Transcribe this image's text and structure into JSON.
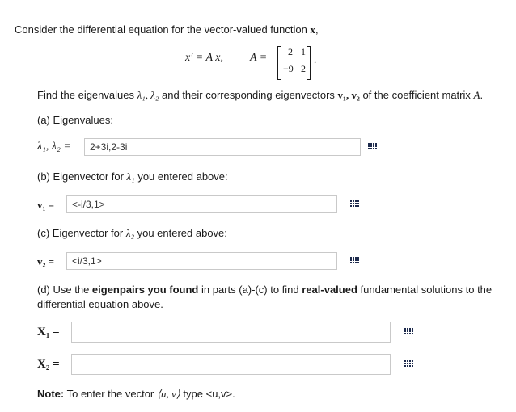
{
  "intro": {
    "text_prefix": "Consider the differential equation for the vector-valued function ",
    "var": "x",
    "text_suffix": ","
  },
  "equation": {
    "lhs": "x′ = A x,",
    "A_label": "A =",
    "matrix": [
      [
        "2",
        "1"
      ],
      [
        "−9",
        "2"
      ]
    ],
    "end": "."
  },
  "prompt": {
    "text1": "Find the eigenvalues ",
    "lambdas": "λ₁, λ₂",
    "text2": " and their corresponding eigenvectors ",
    "vecs": "v₁, v₂",
    "text3": " of the coefficient matrix ",
    "A": "A",
    "end": "."
  },
  "part_a": {
    "label": "(a) Eigenvalues:",
    "math": "λ₁, λ₂ =",
    "value": "2+3i,2-3i"
  },
  "part_b": {
    "label_prefix": "(b) Eigenvector for ",
    "label_suffix": " you entered above:",
    "lambda": "λ₁",
    "math": "v₁ =",
    "value": "<-i/3,1>"
  },
  "part_c": {
    "label_prefix": "(c) Eigenvector for ",
    "label_suffix": " you entered above:",
    "lambda": "λ₂",
    "math": "v₂ =",
    "value": "<i/3,1>"
  },
  "part_d": {
    "t1": "(d) Use the ",
    "b1": "eigenpairs you found",
    "t2": " in parts (a)-(c) to find ",
    "b2": "real-valued",
    "t3": " fundamental solutions to the",
    "line2": "differential equation above.",
    "x1": "X₁ =",
    "x2": "X₂ =",
    "x1_value": "",
    "x2_value": ""
  },
  "note": {
    "label": "Note:",
    "text": " To enter the vector ",
    "math": "⟨u, v⟩",
    "text2": " type <u,v>."
  },
  "icons": {
    "keyboard": "keypad-icon"
  }
}
